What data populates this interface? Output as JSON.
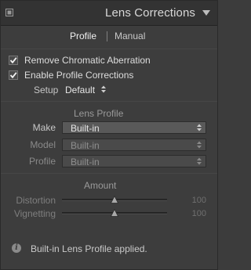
{
  "panel": {
    "title": "Lens Corrections"
  },
  "tabs": [
    {
      "label": "Profile",
      "active": true
    },
    {
      "label": "Manual",
      "active": false
    }
  ],
  "options": {
    "remove_ca": {
      "label": "Remove Chromatic Aberration",
      "checked": true
    },
    "enable_profile": {
      "label": "Enable Profile Corrections",
      "checked": true
    }
  },
  "setup": {
    "label": "Setup",
    "value": "Default"
  },
  "lens_profile": {
    "title": "Lens Profile",
    "fields": [
      {
        "label": "Make",
        "value": "Built-in",
        "enabled": true
      },
      {
        "label": "Model",
        "value": "Built-in",
        "enabled": false
      },
      {
        "label": "Profile",
        "value": "Built-in",
        "enabled": false
      }
    ]
  },
  "amount": {
    "title": "Amount",
    "sliders": [
      {
        "label": "Distortion",
        "value": "100",
        "level": 0.5,
        "enabled": false
      },
      {
        "label": "Vignetting",
        "value": "100",
        "level": 0.5,
        "enabled": false
      }
    ]
  },
  "status": {
    "message": "Built-in Lens Profile applied.",
    "icon": "info-icon"
  },
  "colors": {
    "panel_bg": "#3d3d3d",
    "header_bg": "#333333",
    "text": "#d6d6d6",
    "disabled_text": "#8a8a8a"
  }
}
